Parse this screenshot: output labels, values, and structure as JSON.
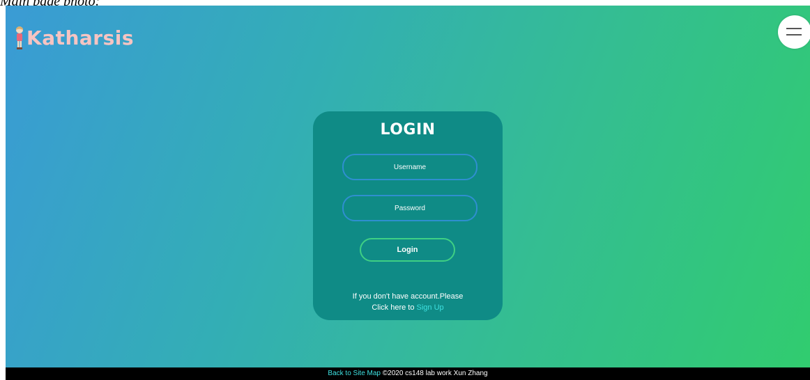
{
  "caption": "Main page photo:",
  "header": {
    "logo_text": "Katharsis",
    "menu_icon": "hamburger-menu-icon"
  },
  "login": {
    "title": "LOGIN",
    "username_placeholder": "Username",
    "password_placeholder": "Password",
    "login_label": "Login",
    "signup_line1": "If you don't have account.Please",
    "signup_line2_prefix": "Click here to",
    "signup_link": "Sign Up"
  },
  "footer": {
    "site_map_link": "Back to Site Map",
    "copyright": "©2020 cs148 lab work Xun Zhang"
  },
  "colors": {
    "gradient_start": "#3a9bd5",
    "gradient_end": "#31cc6f",
    "card_bg": "#0f8b86",
    "logo_text": "#f6c4c2",
    "link": "#3ee0e0",
    "input_border": "#2f8fd0",
    "button_border": "#3fd084"
  }
}
